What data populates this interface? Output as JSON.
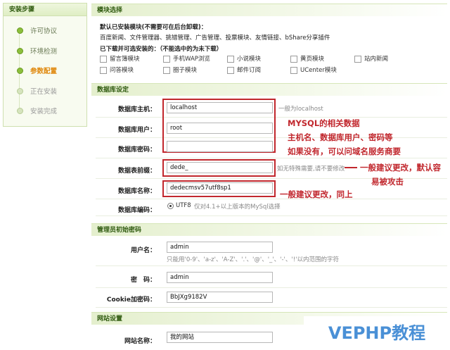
{
  "sidebar": {
    "title": "安装步骤",
    "steps": [
      {
        "label": "许可协议",
        "state": "done"
      },
      {
        "label": "环境检测",
        "state": "done"
      },
      {
        "label": "参数配置",
        "state": "active"
      },
      {
        "label": "正在安装",
        "state": "pending"
      },
      {
        "label": "安装完成",
        "state": "pending"
      }
    ]
  },
  "modules": {
    "title": "模块选择",
    "default_heading": "默认已安装模块(不需要可在后台卸载)：",
    "default_list": "百度新闻、文件管理器、挑错管理、广告管理、投票模块、友情链接、bShare分享插件",
    "optional_heading": "已下载并可选安装的：（不能选中的为未下载）",
    "optional": [
      "留言簿模块",
      "手机WAP浏览",
      "小说模块",
      "黄页模块",
      "站内新闻",
      "问答模块",
      "圈子模块",
      "邮件订阅",
      "UCenter模块"
    ]
  },
  "database": {
    "title": "数据库设定",
    "host_label": "数据库主机：",
    "host_value": "localhost",
    "host_hint": "一般为localhost",
    "user_label": "数据库用户：",
    "user_value": "root",
    "pwd_label": "数据库密码：",
    "pwd_value": "",
    "prefix_label": "数据表前缀：",
    "prefix_value": "dede_",
    "prefix_hint": "如无特殊需要,请不要修改",
    "name_label": "数据库名称：",
    "name_value": "dedecmsv57utf8sp1",
    "encoding_label": "数据库编码：",
    "encoding_option": "UTF8",
    "encoding_hint": "仅对4.1+以上版本的MySql选择"
  },
  "annotations": {
    "mysql_line1": "MYSQL的相关数据",
    "mysql_line2": "主机名、数据库用户、密码等",
    "mysql_line3": "如果没有，可以问域名服务商要",
    "prefix_line1": "一般建议更改，默认容",
    "prefix_line2": "易被攻击",
    "name_note": "一般建议更改，同上"
  },
  "admin": {
    "title": "管理员初始密码",
    "user_label": "用户名：",
    "user_value": "admin",
    "user_hint": "只能用'0-9'、'a-z'、'A-Z'、'.'、'@'、'_'、'-'、'!'以内范围的字符",
    "pwd_label": "密　码：",
    "pwd_value": "admin",
    "cookie_label": "Cookie加密码：",
    "cookie_value": "BbJXg9182V"
  },
  "site": {
    "title": "网站设置",
    "name_label": "网站名称：",
    "name_value": "我的网站"
  },
  "watermark": "VEPHP教程",
  "colors": {
    "accent_red": "#c1272d",
    "brand_green": "#2f5a0f",
    "active_step": "#e08a10",
    "watermark_blue": "#4a90d6"
  }
}
